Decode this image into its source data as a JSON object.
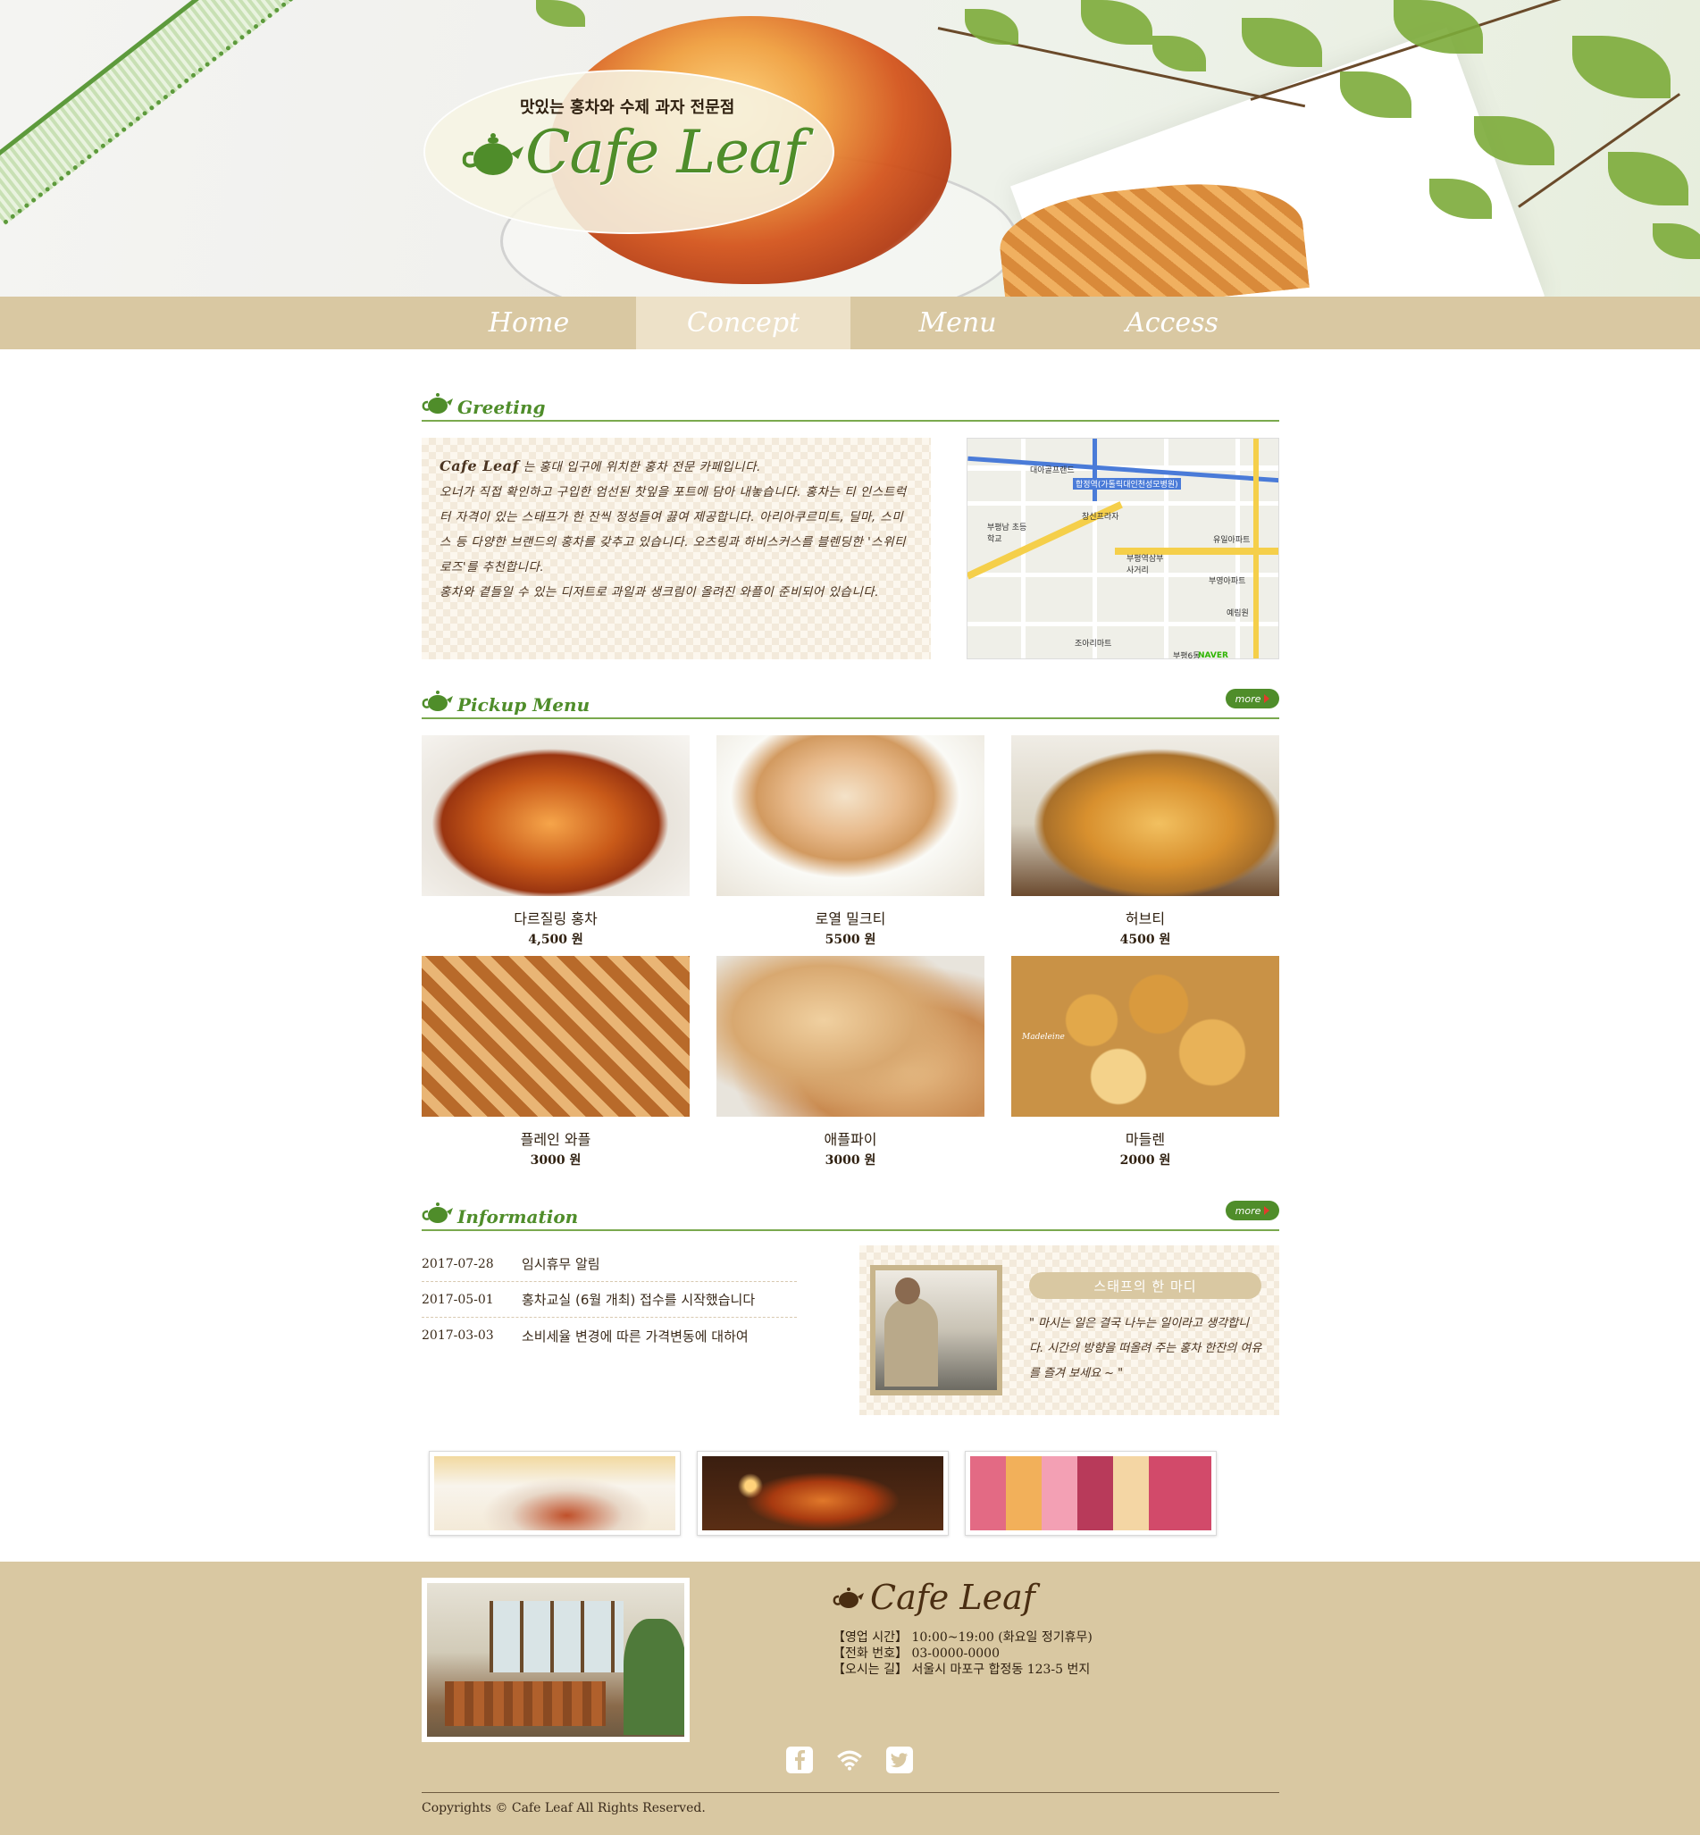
{
  "header": {
    "tagline": "맛있는 홍차와 수제 과자 전문점",
    "logo_text": "Cafe Leaf",
    "logo_icon": "teapot-icon"
  },
  "nav": {
    "items": [
      {
        "label": "Home",
        "active": false
      },
      {
        "label": "Concept",
        "active": true
      },
      {
        "label": "Menu",
        "active": false
      },
      {
        "label": "Access",
        "active": false
      }
    ]
  },
  "greeting": {
    "title": "Greeting",
    "brand": "Cafe Leaf",
    "line1": " 는 홍대 입구에 위치한 홍차 전문 카페입니다.",
    "line2": "오너가 직접 확인하고 구입한 엄선된 찻잎을 포트에 담아 내놓습니다. 홍차는 티 인스트럭터 자격이 있는 스태프가 한 잔씩 정성들여 끓여 제공합니다. 아리아쿠르미트, 딜마, 스미스 등 다양한 브랜드의 홍차를 갖추고 있습니다. 오츠링과 하비스커스를 블렌딩한 '스위티로즈'를 추천합니다.",
    "line3": "홍차와 곁들일 수 있는 디저트로 과일과 생크림이 올려진 와플이 준비되어 있습니다.",
    "map_labels": {
      "a": "대아골프랜드",
      "b": "합정역(가톨릭대인천성모병원)",
      "c": "창신프라자",
      "d": "부평남 초등학교",
      "e": "유일아파트",
      "f": "부평역삼부 사거리",
      "g": "부영아파트",
      "h": "예림원",
      "i": "조아리마트",
      "j": "부평6동",
      "k": "NAVER"
    }
  },
  "pickup": {
    "title": "Pickup Menu",
    "more_label": "more",
    "items": [
      {
        "name": "다르질링 홍차",
        "price": "4,500 원",
        "image": "darjeeling-tea"
      },
      {
        "name": "로열 밀크티",
        "price": "5500 원",
        "image": "royal-milk-tea"
      },
      {
        "name": "허브티",
        "price": "4500 원",
        "image": "herb-tea"
      },
      {
        "name": "플레인 와플",
        "price": "3000 원",
        "image": "plain-waffle"
      },
      {
        "name": "애플파이",
        "price": "3000 원",
        "image": "apple-pie"
      },
      {
        "name": "마들렌",
        "price": "2000 원",
        "image": "madeleine"
      }
    ],
    "madeleine_caption": "Madeleine"
  },
  "information": {
    "title": "Information",
    "more_label": "more",
    "news": [
      {
        "date": "2017-07-28",
        "title": "임시휴무 알림"
      },
      {
        "date": "2017-05-01",
        "title": "홍차교실 (6월 개최) 접수를 시작했습니다"
      },
      {
        "date": "2017-03-03",
        "title": "소비세율 변경에 따른 가격변동에 대하여"
      }
    ],
    "staff_badge": "스태프의 한 마디",
    "staff_quote": "\" 마시는 일은 결국 나누는 일이라고 생각합니다. 시간의 방향을 떠올려 주는 홍차 한잔의 여유를 즐겨 보세요 ~ \""
  },
  "banners": [
    "tea-pouring",
    "candle-tea",
    "macarons"
  ],
  "footer": {
    "logo_text": "Cafe Leaf",
    "hours_label": "【영업 시간】",
    "hours_value": "10:00~19:00 (화요일 정기휴무)",
    "phone_label": "【전화 번호】",
    "phone_value": "03-0000-0000",
    "addr_label": "【오시는 길】",
    "addr_value": "서울시 마포구 합정동 123-5 번지",
    "social": [
      "facebook-icon",
      "wifi-icon",
      "twitter-icon"
    ],
    "copyright": "Copyrights © Cafe Leaf All Rights Reserved."
  },
  "colors": {
    "accent_green": "#4f8d2a",
    "nav_bg": "#d9c8a2",
    "nav_active": "#ede1c8",
    "text_brown": "#3a2a1a"
  }
}
